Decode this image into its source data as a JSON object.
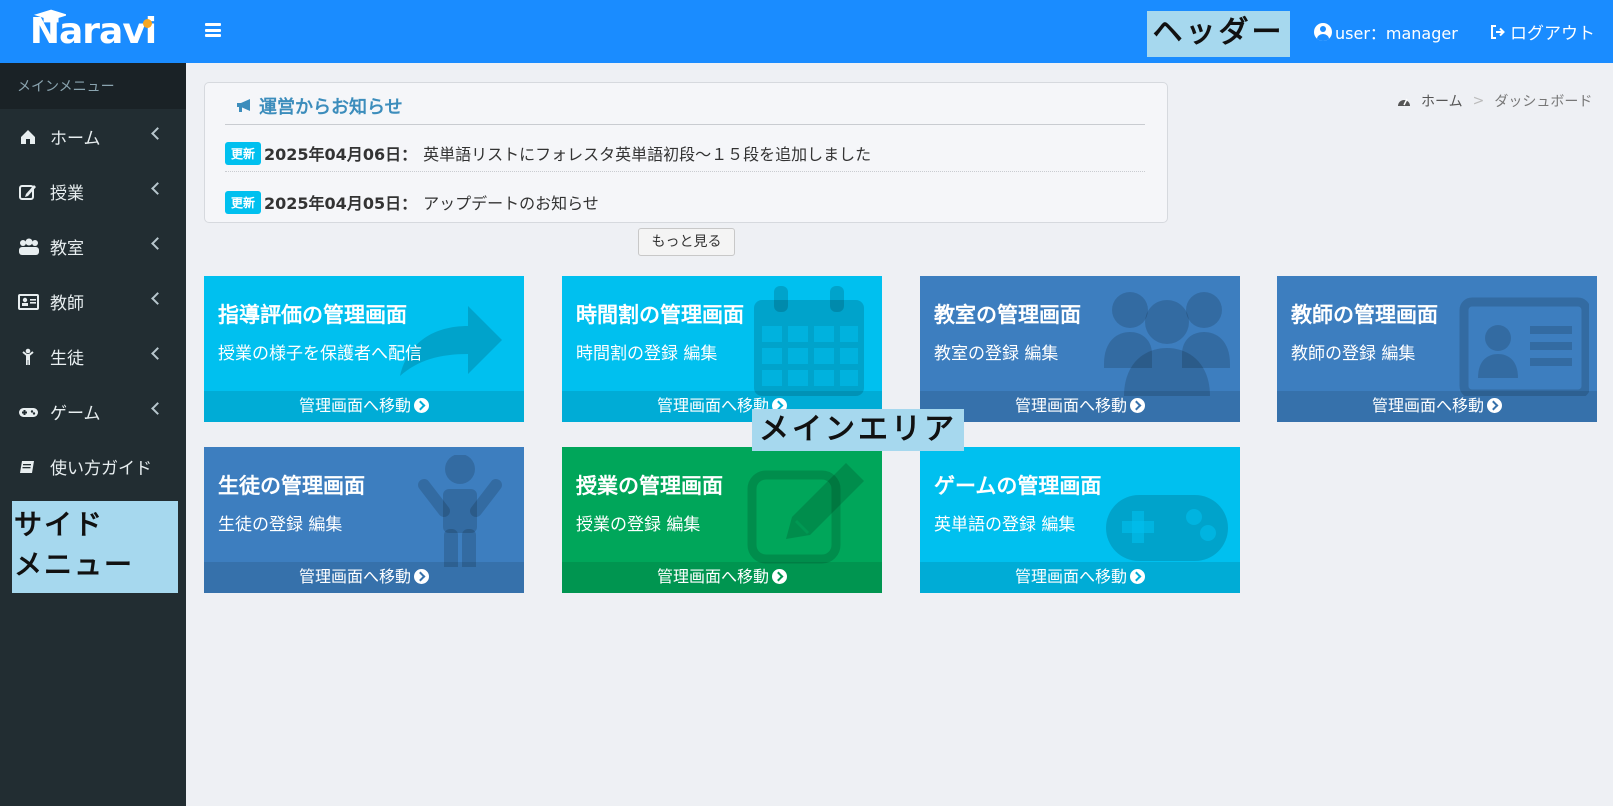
{
  "brand": {
    "name": "Naravi"
  },
  "sidebar": {
    "header": "メインメニュー",
    "items": [
      {
        "label": "ホーム",
        "icon": "home-icon",
        "has_submenu": true
      },
      {
        "label": "授業",
        "icon": "edit-icon",
        "has_submenu": true
      },
      {
        "label": "教室",
        "icon": "users-icon",
        "has_submenu": true
      },
      {
        "label": "教師",
        "icon": "id-card-icon",
        "has_submenu": true
      },
      {
        "label": "生徒",
        "icon": "child-icon",
        "has_submenu": true
      },
      {
        "label": "ゲーム",
        "icon": "gamepad-icon",
        "has_submenu": true
      },
      {
        "label": "使い方ガイド",
        "icon": "book-icon",
        "has_submenu": false
      }
    ],
    "annotation": "サイド\nメニュー"
  },
  "header": {
    "annotation": "ヘッダー",
    "user_label": "user：manager",
    "logout_label": "ログアウト"
  },
  "notice": {
    "title": "運営からお知らせ",
    "items": [
      {
        "badge": "更新",
        "date": "2025年04月06日：",
        "text": "英単語リストにフォレスタ英単語初段〜１５段を追加しました"
      },
      {
        "badge": "更新",
        "date": "2025年04月05日：",
        "text": "アップデートのお知らせ"
      }
    ],
    "more_label": "もっと見る"
  },
  "breadcrumb": {
    "home": "ホーム",
    "separator": ">",
    "current": "ダッシュボード"
  },
  "main_annotation": "メインエリア",
  "boxes": [
    {
      "title": "指導評価の管理画面",
      "subtitle": "授業の様子を保護者へ配信",
      "footer": "管理画面へ移動",
      "color": "#00c0ef",
      "icon": "share-arrow-icon"
    },
    {
      "title": "時間割の管理画面",
      "subtitle": "時間割の登録 編集",
      "footer": "管理画面へ移動",
      "color": "#00c0ef",
      "icon": "calendar-icon"
    },
    {
      "title": "教室の管理画面",
      "subtitle": "教室の登録 編集",
      "footer": "管理画面へ移動",
      "color": "#3d7ebf",
      "icon": "users-icon"
    },
    {
      "title": "教師の管理画面",
      "subtitle": "教師の登録 編集",
      "footer": "管理画面へ移動",
      "color": "#3d7ebf",
      "icon": "id-card-icon"
    },
    {
      "title": "生徒の管理画面",
      "subtitle": "生徒の登録 編集",
      "footer": "管理画面へ移動",
      "color": "#3d7ebf",
      "icon": "child-icon"
    },
    {
      "title": "授業の管理画面",
      "subtitle": "授業の登録 編集",
      "footer": "管理画面へ移動",
      "color": "#00a65a",
      "icon": "edit-icon"
    },
    {
      "title": "ゲームの管理画面",
      "subtitle": "英単語の登録 編集",
      "footer": "管理画面へ移動",
      "color": "#00c0ef",
      "icon": "gamepad-icon"
    }
  ]
}
